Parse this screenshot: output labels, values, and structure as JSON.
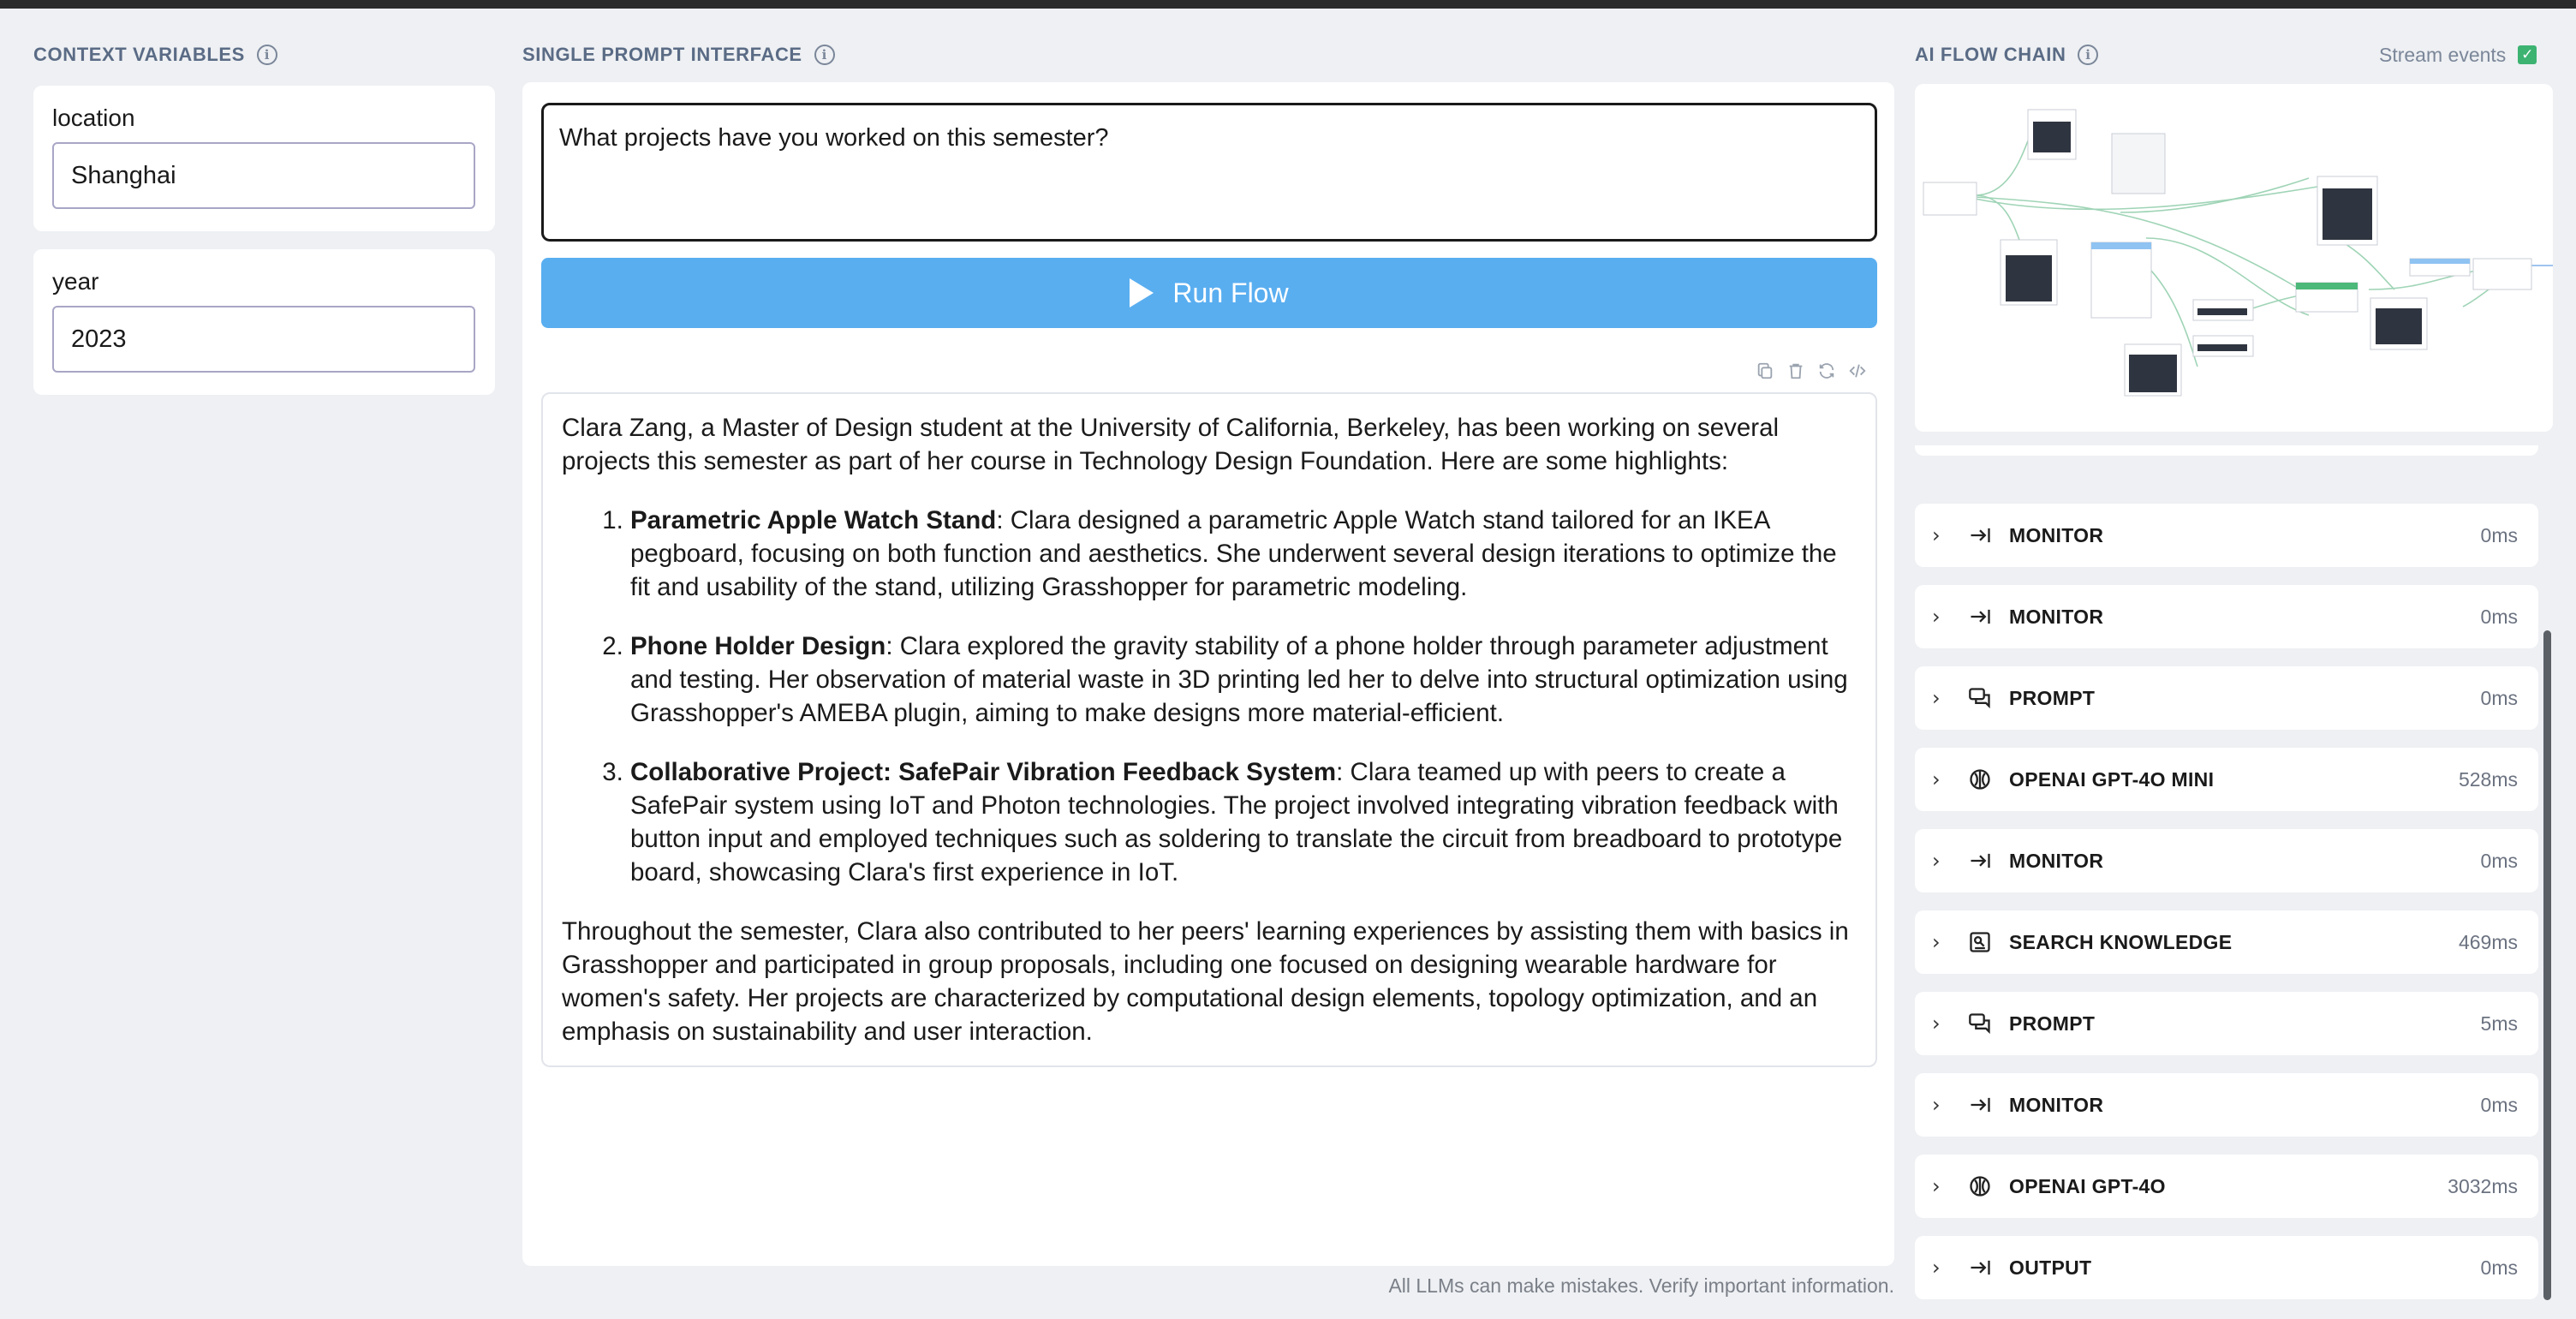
{
  "context_vars": {
    "title": "CONTEXT VARIABLES",
    "fields": [
      {
        "label": "location",
        "value": "Shanghai"
      },
      {
        "label": "year",
        "value": "2023"
      }
    ]
  },
  "prompt_panel": {
    "title": "SINGLE PROMPT INTERFACE",
    "prompt_value": "What projects have you worked on this semester?",
    "run_label": "Run Flow"
  },
  "response": {
    "intro": "Clara Zang, a Master of Design student at the University of California, Berkeley, has been working on several projects this semester as part of her course in Technology Design Foundation. Here are some highlights:",
    "items": [
      {
        "title": "Parametric Apple Watch Stand",
        "text": ": Clara designed a parametric Apple Watch stand tailored for an IKEA pegboard, focusing on both function and aesthetics. She underwent several design iterations to optimize the fit and usability of the stand, utilizing Grasshopper for parametric modeling."
      },
      {
        "title": "Phone Holder Design",
        "text": ": Clara explored the gravity stability of a phone holder through parameter adjustment and testing. Her observation of material waste in 3D printing led her to delve into structural optimization using Grasshopper's AMEBA plugin, aiming to make designs more material-efficient."
      },
      {
        "title": "Collaborative Project: SafePair Vibration Feedback System",
        "text": ": Clara teamed up with peers to create a SafePair system using IoT and Photon technologies. The project involved integrating vibration feedback with button input and employed techniques such as soldering to translate the circuit from breadboard to prototype board, showcasing Clara's first experience in IoT."
      }
    ],
    "outro": "Throughout the semester, Clara also contributed to her peers' learning experiences by assisting them with basics in Grasshopper and participated in group proposals, including one focused on designing wearable hardware for women's safety. Her projects are characterized by computational design elements, topology optimization, and an emphasis on sustainability and user interaction."
  },
  "disclaimer": "All LLMs can make mistakes. Verify important information.",
  "flow_chain": {
    "title": "AI FLOW CHAIN",
    "stream_label": "Stream events",
    "stream_checked": true,
    "items": [
      {
        "label": "MONITOR",
        "time": "0ms",
        "icon": "arrow-to-line-icon"
      },
      {
        "label": "MONITOR",
        "time": "0ms",
        "icon": "arrow-to-line-icon"
      },
      {
        "label": "PROMPT",
        "time": "0ms",
        "icon": "chat-bubbles-icon"
      },
      {
        "label": "OPENAI GPT-4O MINI",
        "time": "528ms",
        "icon": "openai-logo-icon"
      },
      {
        "label": "MONITOR",
        "time": "0ms",
        "icon": "arrow-to-line-icon"
      },
      {
        "label": "SEARCH KNOWLEDGE",
        "time": "469ms",
        "icon": "knowledge-search-icon"
      },
      {
        "label": "PROMPT",
        "time": "5ms",
        "icon": "chat-bubbles-icon"
      },
      {
        "label": "MONITOR",
        "time": "0ms",
        "icon": "arrow-to-line-icon"
      },
      {
        "label": "OPENAI GPT-4O",
        "time": "3032ms",
        "icon": "openai-logo-icon"
      },
      {
        "label": "OUTPUT",
        "time": "0ms",
        "icon": "arrow-to-line-icon"
      }
    ]
  },
  "colors": {
    "accent": "#59aef0",
    "section_header": "#5a6b85",
    "stream_check": "#3cb371"
  }
}
